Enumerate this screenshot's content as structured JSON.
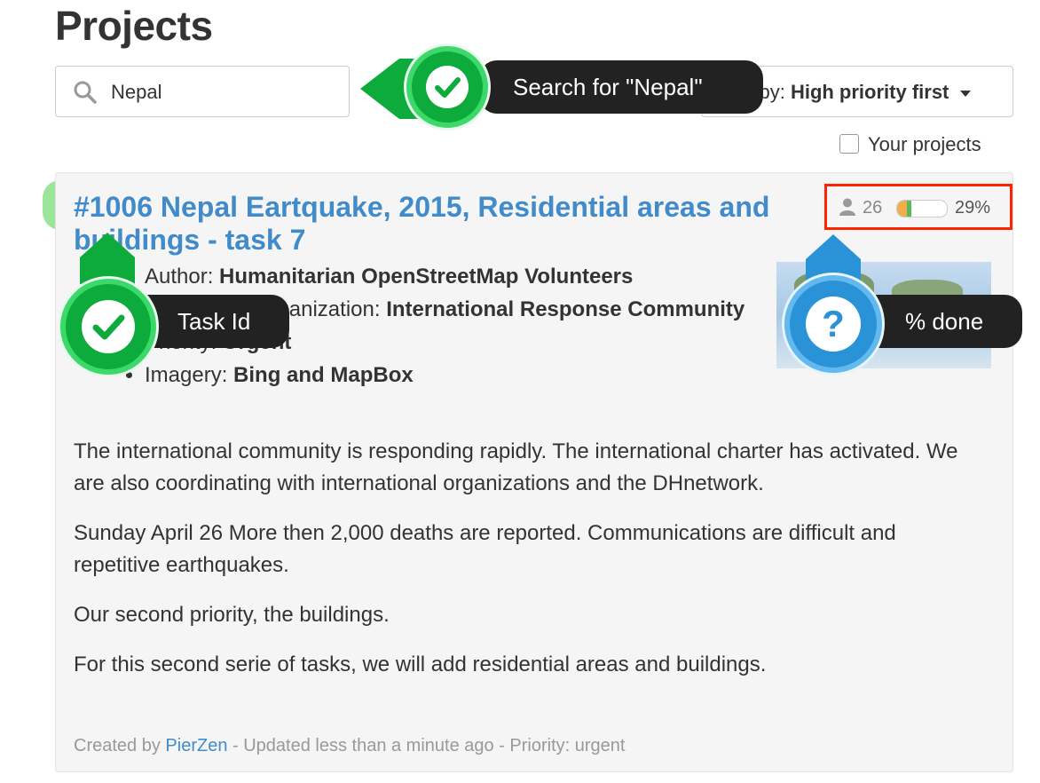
{
  "page": {
    "title": "Projects"
  },
  "search": {
    "value": "Nepal"
  },
  "sort": {
    "label": "Sort by:",
    "value": "High priority first"
  },
  "filter": {
    "your_projects_label": "Your projects",
    "checked": false
  },
  "project": {
    "id": "#1006",
    "title": "Nepal Eartquake, 2015, Residential areas and buildings - task 7",
    "contributors": "26",
    "progress_pct": 29,
    "progress_label": "29%",
    "meta": [
      {
        "key": "Author: ",
        "value": "Humanitarian OpenStreetMap Volunteers"
      },
      {
        "key": "Requesting organization: ",
        "value": "International Response Community"
      },
      {
        "key": "Priority: ",
        "value": "Urgent"
      },
      {
        "key": "Imagery: ",
        "value": "Bing and MapBox"
      }
    ],
    "description": [
      "The international community is responding rapidly. The international charter has activated. We are also coordinating with international organizations and the DHnetwork.",
      "Sunday April 26 More then 2,000 deaths are reported. Communications are difficult and repetitive earthquakes.",
      "Our second priority, the buildings.",
      "For this second serie of tasks, we will add residential areas and buildings."
    ],
    "footer": {
      "created_by_label": "Created by",
      "author": "PierZen",
      "updated": "- Updated less than a minute ago - Priority: urgent"
    }
  },
  "annotations": {
    "search_tip": "Search for \"Nepal\"",
    "task_id_tip": "Task Id",
    "done_tip": "% done",
    "question_mark": "?"
  },
  "colors": {
    "link": "#428bca",
    "progress_done": "#5cb85c",
    "progress_partial": "#f0ad4e",
    "annotation_green": "#0dab3b",
    "annotation_blue": "#2a93d8",
    "stats_outline": "#ff2200"
  }
}
